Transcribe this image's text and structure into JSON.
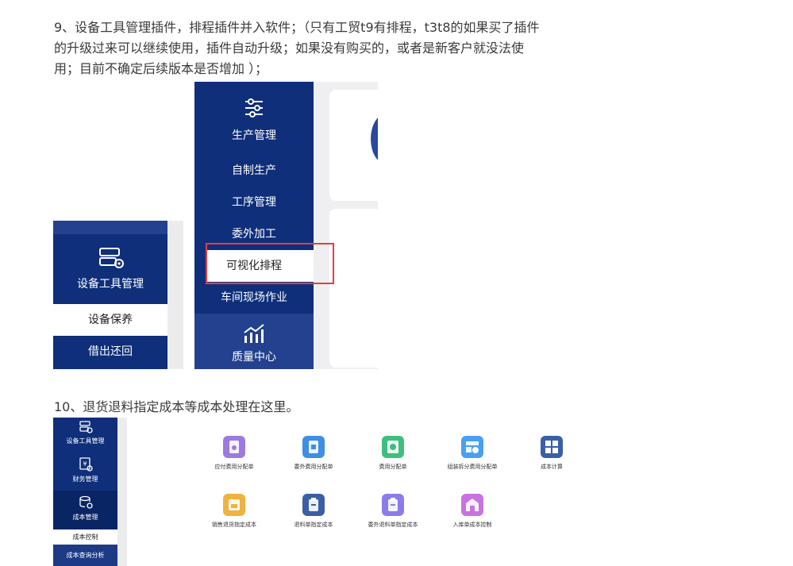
{
  "paragraph1": "9、设备工具管理插件，排程插件并入软件；（只有工贸t9有排程，t3t8的如果买了插件\n的升级过来可以继续使用，插件自动升级；如果没有购买的，或者是新客户就没法使\n用；目前不确定后续版本是否增加 ）；",
  "paragraph2": "10、退货退料指定成本等成本处理在这里。",
  "equipment_panel": {
    "module_title": "设备工具管理",
    "items": [
      "设备保养",
      "借出还回"
    ]
  },
  "production_panel": {
    "module_title": "生产管理",
    "items": [
      "自制生产",
      "工序管理",
      "委外加工",
      "可视化排程",
      "车间现场作业"
    ],
    "highlighted_item": "可视化排程",
    "next_module": "质量中心"
  },
  "cost_panel": {
    "sidebar": [
      "设备工具管理",
      "财务管理",
      "成本管理"
    ],
    "sub_items": [
      "成本控制",
      "成本查询分析"
    ],
    "tiles": [
      {
        "label": "应付费用分配单",
        "color": "#9b7be0",
        "icon": "document-icon"
      },
      {
        "label": "委外费用分配单",
        "color": "#3e8ee6",
        "icon": "document-icon"
      },
      {
        "label": "费用分配单",
        "color": "#3fbf7f",
        "icon": "coin-icon"
      },
      {
        "label": "组装拆分费用分配单",
        "color": "#4aa0f0",
        "icon": "grid-icon"
      },
      {
        "label": "成本计算",
        "color": "#3a5fa6",
        "icon": "calculator-icon"
      },
      {
        "label": "销售退货指定成本",
        "color": "#f0b240",
        "icon": "return-icon"
      },
      {
        "label": "退料单指定成本",
        "color": "#3a5fa6",
        "icon": "clipboard-icon"
      },
      {
        "label": "委外退料单指定成本",
        "color": "#8b7ce8",
        "icon": "clipboard-icon"
      },
      {
        "label": "入库单成本控制",
        "color": "#c774e0",
        "icon": "warehouse-icon"
      }
    ]
  }
}
